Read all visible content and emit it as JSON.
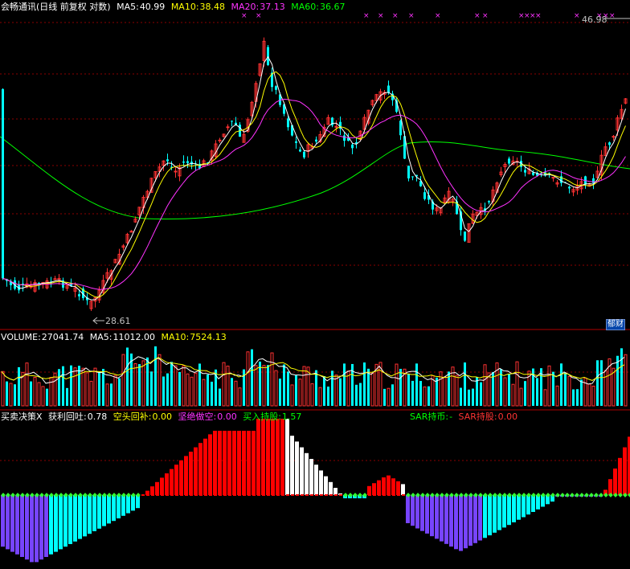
{
  "price_panel": {
    "name": "会畅通讯",
    "mode": "(日线 前复权 对数)",
    "ma5_label": "MA5:",
    "ma5_value": "40.99",
    "ma10_label": "MA10:",
    "ma10_value": "38.48",
    "ma20_label": "MA20:",
    "ma20_value": "37.13",
    "ma60_label": "MA60:",
    "ma60_value": "36.67",
    "high_label": "46.98",
    "low_label": "28.61",
    "corner_tag": "郁财",
    "colors": {
      "ma5": "#ffffff",
      "ma10": "#ffff00",
      "ma20": "#ff33ff",
      "ma60": "#00ff00",
      "up": "#ff3232",
      "down": "#00ffff",
      "marker": "#ff33ff",
      "grid": "#8b0000"
    }
  },
  "volume_panel": {
    "vol_label": "VOLUME:",
    "vol_value": "27041.74",
    "ma5_label": "MA5:",
    "ma5_value": "11012.00",
    "ma10_label": "MA10:",
    "ma10_value": "7524.13"
  },
  "indicator_panel": {
    "title": "买卖决策X",
    "profit_label": "获利回吐:",
    "profit_value": "0.78",
    "short_label": "空头回补:",
    "short_value": "0.00",
    "sell_label": "坚绝做空:",
    "sell_value": "0.00",
    "buy_label": "买入持股:",
    "buy_value": "1.57",
    "sar_coin_label": "SAR持币:",
    "sar_coin_value": "-",
    "sar_hold_label": "SAR持股:",
    "sar_hold_value": "0.00",
    "colors": {
      "red": "#ff0000",
      "white": "#ffffff",
      "cyan": "#00ffff",
      "blue": "#7744ff",
      "green": "#33ff33"
    }
  }
}
